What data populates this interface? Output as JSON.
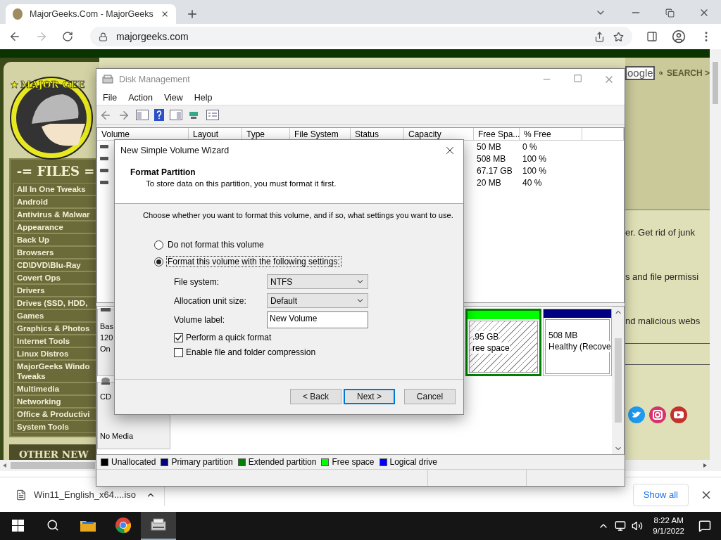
{
  "browser": {
    "tabs": [
      {
        "title": "MajorGeeks.Com - MajorGeeks",
        "selected": true
      }
    ],
    "address": "majorgeeks.com"
  },
  "site": {
    "logo_text": "MAJOR GEE",
    "files_heading": "-= FILES =",
    "categories": [
      "All In One Tweaks",
      "Android",
      "Antivirus & Malwar",
      "Appearance",
      "Back Up",
      "Browsers",
      "CD\\DVD\\Blu-Ray",
      "Covert Ops",
      "Drivers",
      "Drives (SSD, HDD,",
      "Games",
      "Graphics & Photos",
      "Internet Tools",
      "Linux Distros",
      "MajorGeeks Windo\nTweaks",
      "Multimedia",
      "Networking",
      "Office & Productivi",
      "System Tools"
    ],
    "other_heading": "OTHER NEW",
    "search_value": "oogle",
    "search_button": "SEARCH >",
    "snippets": [
      "er. Get rid of junk",
      "s and file permissi",
      "nd malicious webs"
    ]
  },
  "disk_management": {
    "title": "Disk Management",
    "menu": [
      "File",
      "Action",
      "View",
      "Help"
    ],
    "columns": [
      "Volume",
      "Layout",
      "Type",
      "File System",
      "Status",
      "Capacity",
      "Free Spa...",
      "% Free"
    ],
    "rows": [
      {
        "free": "50 MB",
        "percent": "0 %"
      },
      {
        "free": "508 MB",
        "percent": "100 %"
      },
      {
        "free": "67.17 GB",
        "percent": "100 %"
      },
      {
        "free": "20 MB",
        "percent": "40 %"
      }
    ],
    "disks": [
      {
        "kind": "disk",
        "lines": [
          "Bas",
          "120",
          "On"
        ]
      },
      {
        "kind": "cdrom",
        "lines": [
          "CD",
          "No Media"
        ]
      }
    ],
    "partitions": [
      {
        "kind": "free",
        "color": "#00ff00",
        "lines": [
          ".95 GB",
          "ree space"
        ]
      },
      {
        "kind": "primary",
        "color": "#000080",
        "lines": [
          "508 MB",
          "Healthy (Recove"
        ]
      }
    ],
    "legend": [
      {
        "label": "Unallocated",
        "color": "#000000"
      },
      {
        "label": "Primary partition",
        "color": "#000080"
      },
      {
        "label": "Extended partition",
        "color": "#008000"
      },
      {
        "label": "Free space",
        "color": "#00ff00"
      },
      {
        "label": "Logical drive",
        "color": "#0000ff"
      }
    ]
  },
  "wizard": {
    "title": "New Simple Volume Wizard",
    "heading": "Format Partition",
    "subheading": "To store data on this partition, you must format it first.",
    "instruction": "Choose whether you want to format this volume, and if so, what settings you want to use.",
    "options": [
      {
        "label": "Do not format this volume",
        "selected": false
      },
      {
        "label": "Format this volume with the following settings:",
        "selected": true
      }
    ],
    "fields": [
      {
        "kind": "select",
        "label": "File system:",
        "value": "NTFS"
      },
      {
        "kind": "select",
        "label": "Allocation unit size:",
        "value": "Default"
      },
      {
        "kind": "text",
        "label": "Volume label:",
        "value": "New Volume"
      }
    ],
    "checkboxes": [
      {
        "label": "Perform a quick format",
        "checked": true
      },
      {
        "label": "Enable file and folder compression",
        "checked": false
      }
    ],
    "buttons": [
      {
        "label": "< Back",
        "default": false
      },
      {
        "label": "Next >",
        "default": true
      },
      {
        "label": "Cancel",
        "default": false
      }
    ]
  },
  "downloads": {
    "file": "Win11_English_x64....iso",
    "show_all": "Show all"
  },
  "taskbar": {
    "apps": [
      {
        "kind": "explorer",
        "selected": false
      },
      {
        "kind": "browser",
        "selected": false
      },
      {
        "kind": "disk",
        "selected": true
      }
    ],
    "time": "8:22 AM",
    "date": "9/1/2022"
  }
}
